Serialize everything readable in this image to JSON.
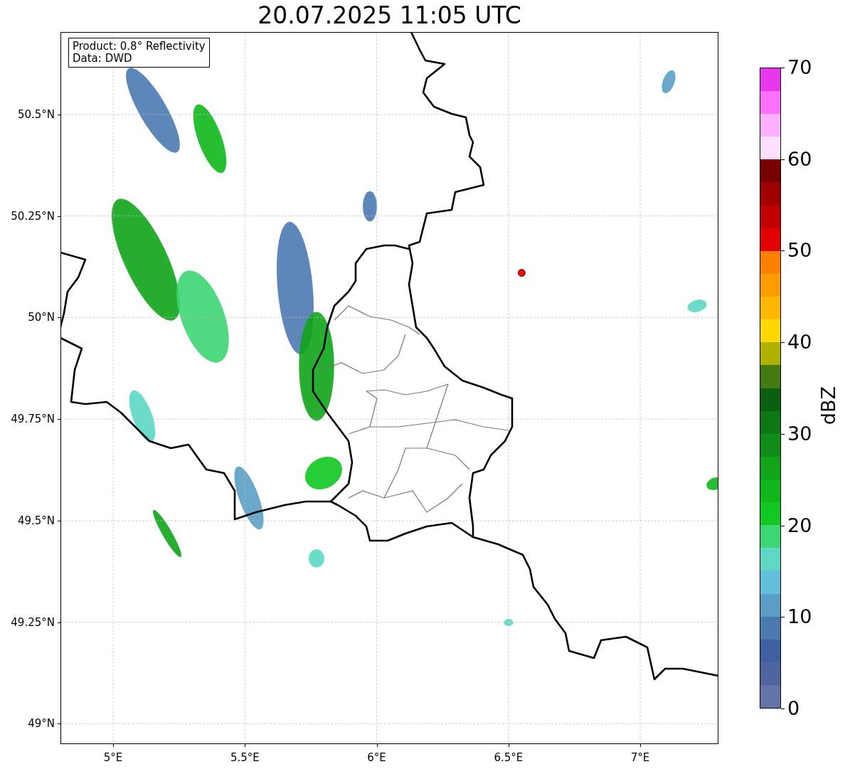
{
  "title": "20.07.2025 11:05 UTC",
  "map": {
    "info_box": [
      "Product: 0.8° Reflectivity",
      "Data: DWD"
    ],
    "x_ticks": [
      "5°E",
      "5.5°E",
      "6°E",
      "6.5°E",
      "7°E"
    ],
    "y_ticks": [
      "50.5°N",
      "50.25°N",
      "50°N",
      "49.75°N",
      "49.5°N",
      "49.25°N",
      "49°N"
    ]
  },
  "colorbar": {
    "label": "dBZ",
    "ticks": [
      "70",
      "60",
      "50",
      "40",
      "30",
      "20",
      "10",
      "0"
    ],
    "segments": [
      {
        "color": "#e838f0"
      },
      {
        "color": "#ff70ff"
      },
      {
        "color": "#ffb0ff"
      },
      {
        "color": "#ffe0ff"
      },
      {
        "color": "#780000"
      },
      {
        "color": "#a00000"
      },
      {
        "color": "#c00000"
      },
      {
        "color": "#e00000"
      },
      {
        "color": "#ff8000"
      },
      {
        "color": "#ff9c00"
      },
      {
        "color": "#ffb800"
      },
      {
        "color": "#ffd800"
      },
      {
        "color": "#b0b000"
      },
      {
        "color": "#447810"
      },
      {
        "color": "#086010"
      },
      {
        "color": "#0c7814"
      },
      {
        "color": "#108c18"
      },
      {
        "color": "#10a418"
      },
      {
        "color": "#10b81c"
      },
      {
        "color": "#10c820"
      },
      {
        "color": "#3cd674"
      },
      {
        "color": "#5ed8c4"
      },
      {
        "color": "#62c0dc"
      },
      {
        "color": "#5a9ec6"
      },
      {
        "color": "#4a7ab0"
      },
      {
        "color": "#4060a4"
      },
      {
        "color": "#5065a0"
      },
      {
        "color": "#6474a8"
      }
    ]
  }
}
